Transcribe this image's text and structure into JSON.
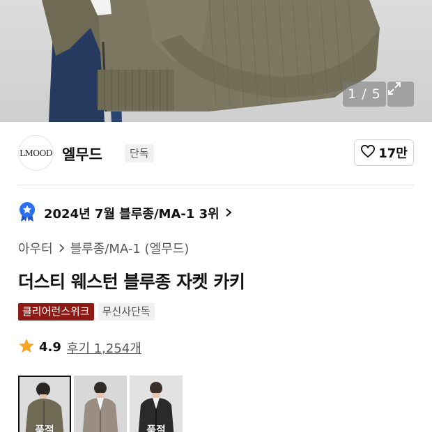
{
  "gallery": {
    "counter": "1 / 5",
    "expand_icon": "expand-icon"
  },
  "brand": {
    "logo_text": "LMOOD",
    "name": "엘무드",
    "badge": "단독",
    "like_count": "17만",
    "like_icon": "heart-outline-icon"
  },
  "ranking": {
    "icon": "rank-badge-icon",
    "text": "2024년 7월 블루종/MA-1 3위",
    "accent_color": "#2b6ff0"
  },
  "breadcrumb": {
    "items": [
      "아우터",
      "블루종/MA-1 (엘무드)"
    ]
  },
  "product": {
    "title": "더스티 웨스턴 블루종 자켓 카키"
  },
  "tags": [
    {
      "label": "클리어런스위크",
      "color": "#8d1a14"
    },
    {
      "label": "무신사단독"
    }
  ],
  "rating": {
    "score": "4.9",
    "review_text": "후기 1,254개",
    "star_color": "#f5a623"
  },
  "thumbnails": [
    {
      "label": "품절",
      "selected": true
    },
    {
      "label": ""
    },
    {
      "label": "품절"
    }
  ]
}
